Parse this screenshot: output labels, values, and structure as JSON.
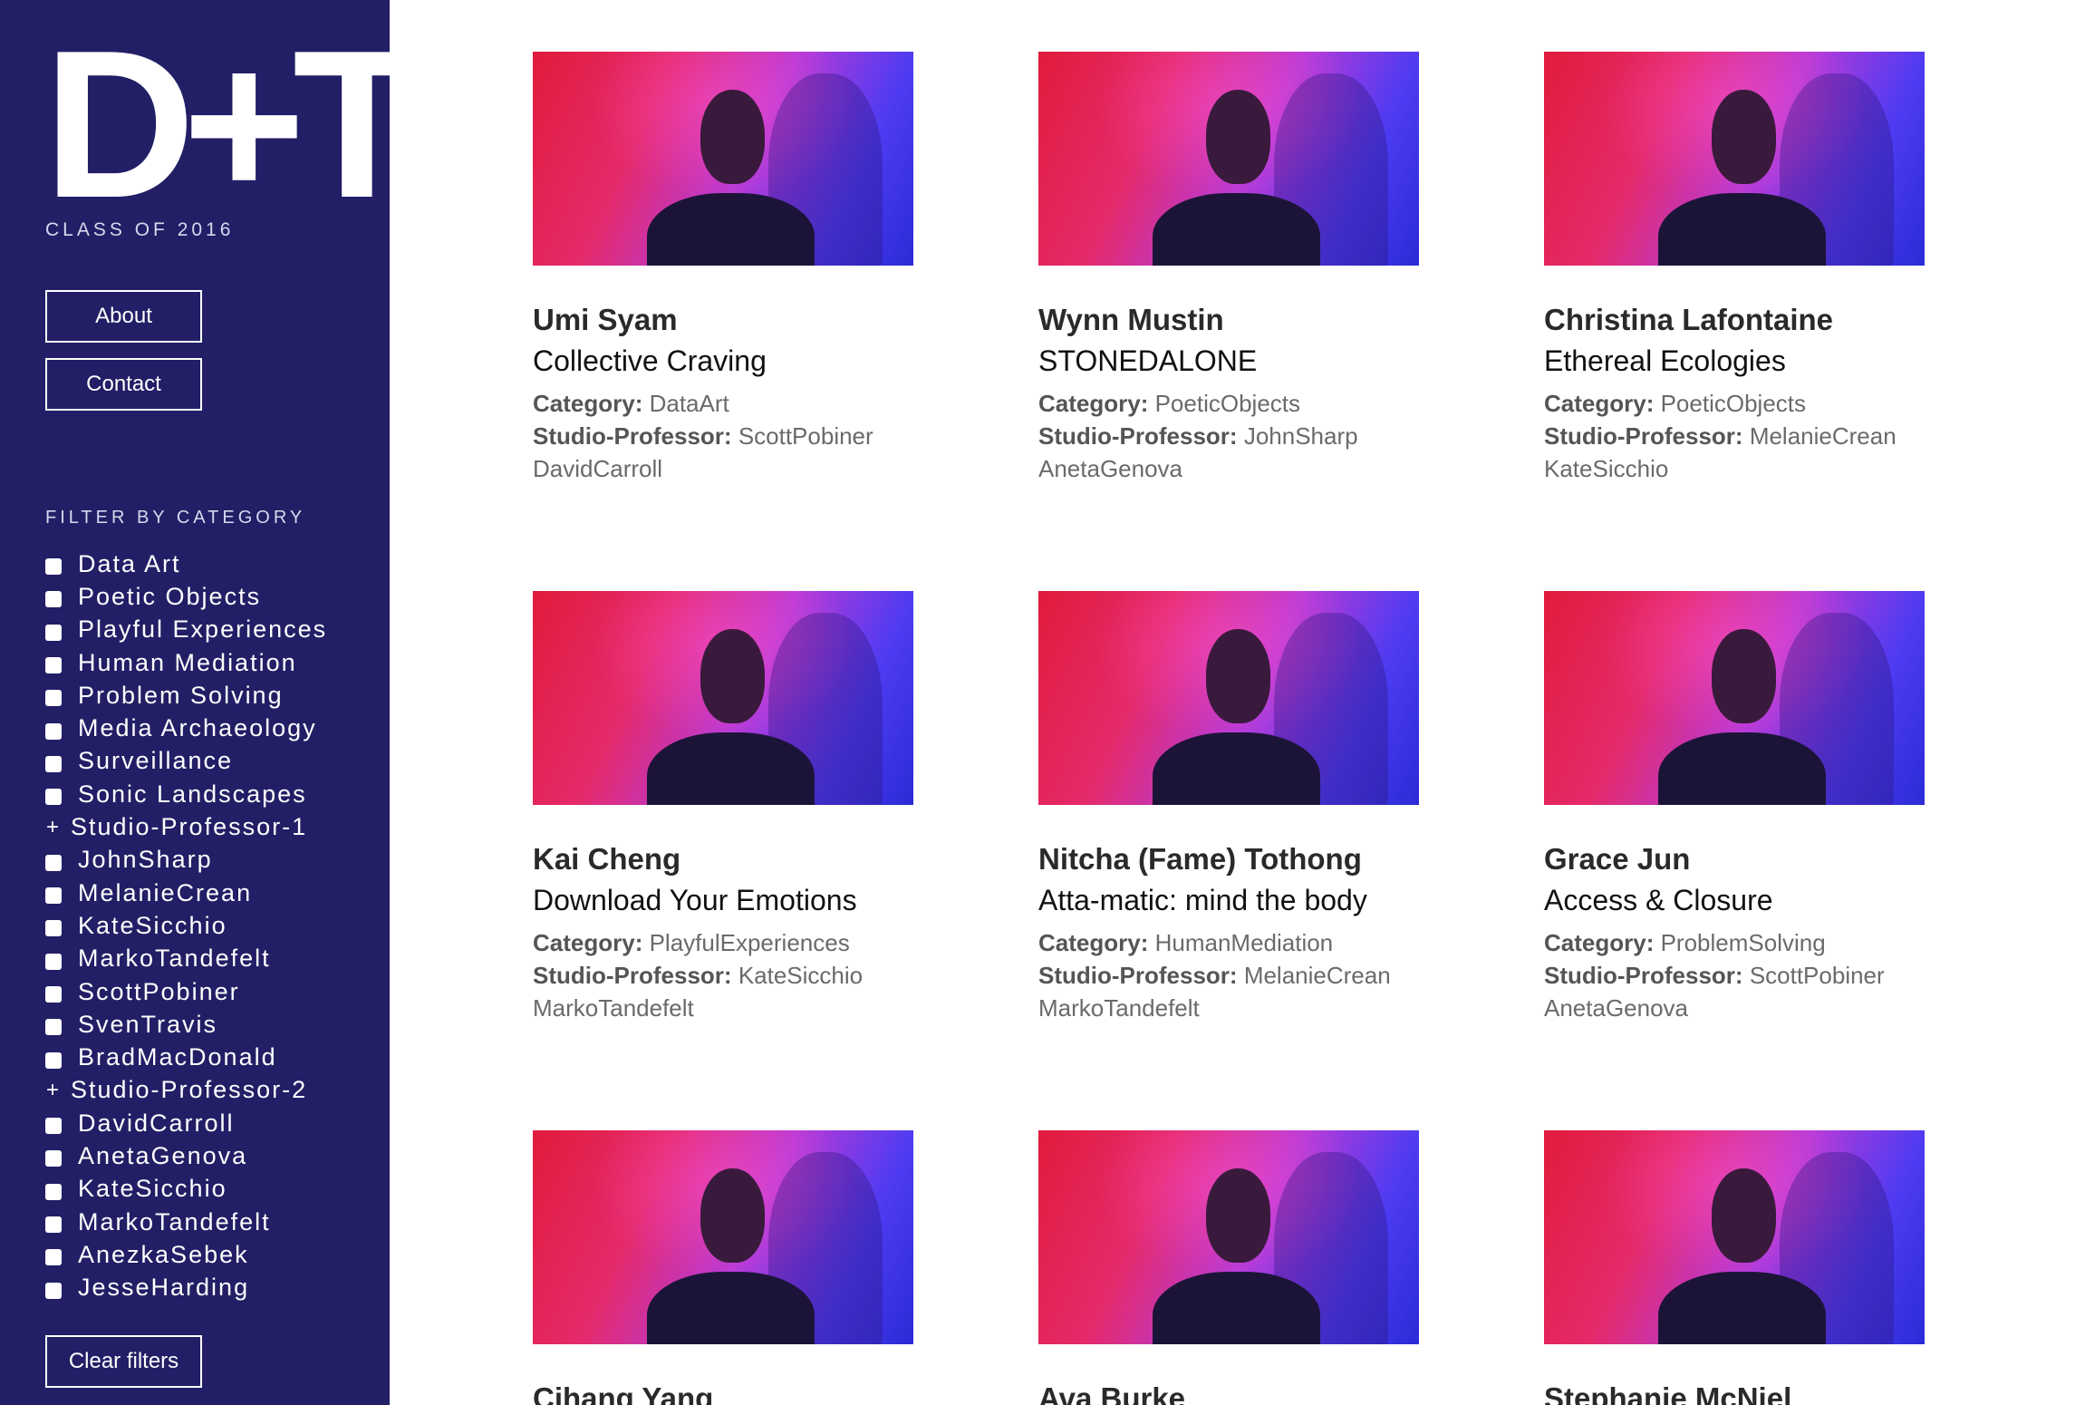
{
  "sidebar": {
    "logo": "D+T",
    "class_of": "CLASS OF 2016",
    "about_label": "About",
    "contact_label": "Contact",
    "filter_heading": "FILTER BY CATEGORY",
    "clear_label": "Clear filters",
    "filters": [
      {
        "label": "Data Art",
        "type": "checkbox"
      },
      {
        "label": "Poetic Objects",
        "type": "checkbox"
      },
      {
        "label": "Playful Experiences",
        "type": "checkbox"
      },
      {
        "label": "Human Mediation",
        "type": "checkbox"
      },
      {
        "label": "Problem Solving",
        "type": "checkbox"
      },
      {
        "label": "Media Archaeology",
        "type": "checkbox"
      },
      {
        "label": "Surveillance",
        "type": "checkbox"
      },
      {
        "label": "Sonic Landscapes",
        "type": "checkbox"
      },
      {
        "label": "Studio-Professor-1",
        "type": "group"
      },
      {
        "label": "JohnSharp",
        "type": "checkbox"
      },
      {
        "label": "MelanieCrean",
        "type": "checkbox"
      },
      {
        "label": "KateSicchio",
        "type": "checkbox"
      },
      {
        "label": "MarkoTandefelt",
        "type": "checkbox"
      },
      {
        "label": "ScottPobiner",
        "type": "checkbox"
      },
      {
        "label": "SvenTravis",
        "type": "checkbox"
      },
      {
        "label": "BradMacDonald",
        "type": "checkbox"
      },
      {
        "label": "Studio-Professor-2",
        "type": "group"
      },
      {
        "label": "DavidCarroll",
        "type": "checkbox"
      },
      {
        "label": "AnetaGenova",
        "type": "checkbox"
      },
      {
        "label": "KateSicchio",
        "type": "checkbox"
      },
      {
        "label": "MarkoTandefelt",
        "type": "checkbox"
      },
      {
        "label": "AnezkaSebek",
        "type": "checkbox"
      },
      {
        "label": "JesseHarding",
        "type": "checkbox"
      }
    ]
  },
  "labels": {
    "category": "Category:",
    "studio_professor": "Studio-Professor:"
  },
  "cards": [
    {
      "name": "Umi Syam",
      "project": "Collective Craving",
      "category": "DataArt",
      "professor": "ScottPobiner",
      "professor2": "DavidCarroll"
    },
    {
      "name": "Wynn Mustin",
      "project": "STONEDALONE",
      "category": "PoeticObjects",
      "professor": "JohnSharp",
      "professor2": "AnetaGenova"
    },
    {
      "name": "Christina Lafontaine",
      "project": "Ethereal Ecologies",
      "category": "PoeticObjects",
      "professor": "MelanieCrean",
      "professor2": "KateSicchio"
    },
    {
      "name": "Kai Cheng",
      "project": "Download Your Emotions",
      "category": "PlayfulExperiences",
      "professor": "KateSicchio",
      "professor2": "MarkoTandefelt"
    },
    {
      "name": "Nitcha (Fame) Tothong",
      "project": "Atta-matic: mind the body",
      "category": "HumanMediation",
      "professor": "MelanieCrean",
      "professor2": "MarkoTandefelt"
    },
    {
      "name": "Grace Jun",
      "project": "Access & Closure",
      "category": "ProblemSolving",
      "professor": "ScottPobiner",
      "professor2": "AnetaGenova"
    },
    {
      "name": "Cihang Yang",
      "project": "",
      "category": "",
      "professor": "",
      "professor2": ""
    },
    {
      "name": "Ava Burke",
      "project": "",
      "category": "",
      "professor": "",
      "professor2": ""
    },
    {
      "name": "Stephanie McNiel",
      "project": "",
      "category": "",
      "professor": "",
      "professor2": ""
    }
  ]
}
